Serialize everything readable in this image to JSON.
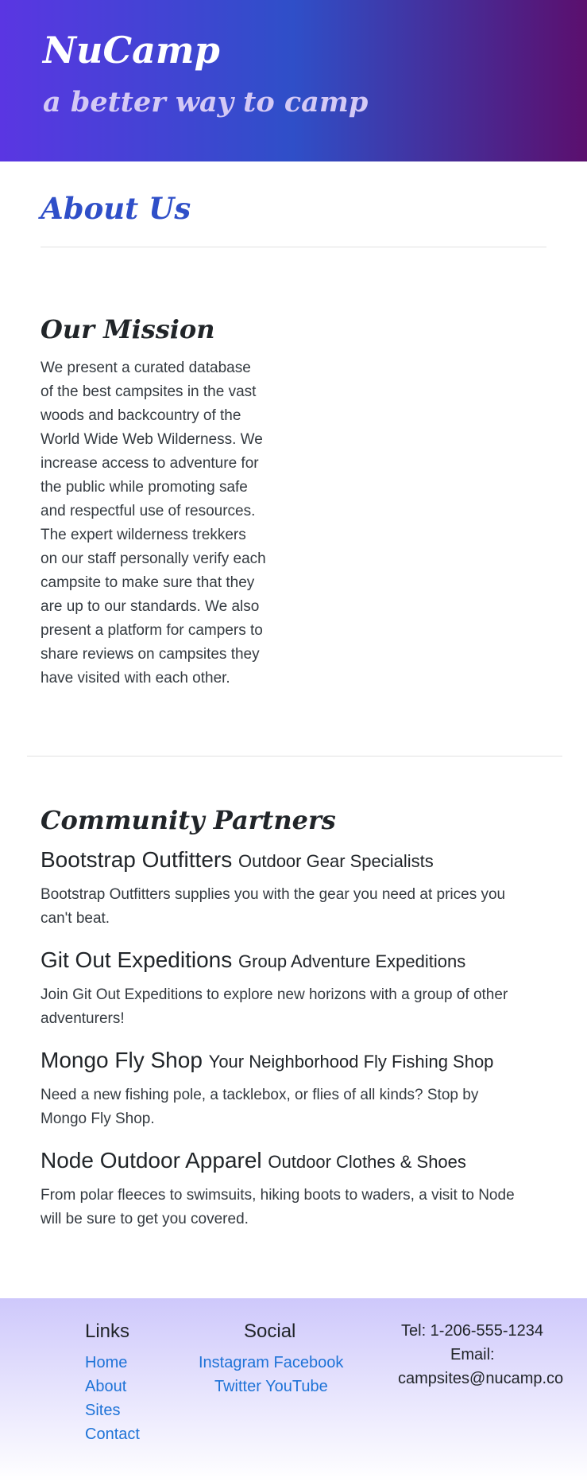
{
  "header": {
    "brand": "NuCamp",
    "tagline": "a better way to camp"
  },
  "about": {
    "title": "About Us"
  },
  "mission": {
    "title": "Our Mission",
    "lines": [
      "We present a curated database",
      "of the best campsites in the vast",
      "woods and backcountry of the",
      "World Wide Web Wilderness. We",
      "increase access to adventure for",
      "the public while promoting safe",
      "and respectful use of resources.",
      "The expert wilderness trekkers",
      "on our staff personally verify each",
      "campsite to make sure that they",
      "are up to our standards. We also",
      "present a platform for campers to",
      "share reviews on campsites they",
      "have visited with each other."
    ]
  },
  "partners": {
    "title": "Community Partners",
    "items": [
      {
        "name": "Bootstrap Outfitters",
        "subtitle": "Outdoor Gear Specialists",
        "lines": [
          "Bootstrap Outfitters supplies you with the gear you need at prices you",
          "can't beat."
        ]
      },
      {
        "name": "Git Out Expeditions",
        "subtitle": "Group Adventure Expeditions",
        "lines": [
          "Join Git Out Expeditions to explore new horizons with a group of other",
          "adventurers!"
        ]
      },
      {
        "name": "Mongo Fly Shop",
        "subtitle": "Your Neighborhood Fly Fishing Shop",
        "lines": [
          "Need a new fishing pole, a tacklebox, or flies of all kinds? Stop by",
          "Mongo Fly Shop."
        ]
      },
      {
        "name": "Node Outdoor Apparel",
        "subtitle": "Outdoor Clothes & Shoes",
        "lines": [
          "From polar fleeces to swimsuits, hiking boots to waders, a visit to Node",
          "will be sure to get you covered."
        ]
      }
    ]
  },
  "footer": {
    "links_title": "Links",
    "links": [
      "Home",
      "About",
      "Sites",
      "Contact"
    ],
    "social_title": "Social",
    "social_row1": "Instagram Facebook",
    "social_row2": "Twitter YouTube",
    "tel": "Tel: 1-206-555-1234",
    "email_label": "Email:",
    "email": "campsites@nucamp.co",
    "link_color": "#1e73d7"
  },
  "colors": {
    "accent": "#2f4fc8",
    "header_start": "#5a36e2",
    "header_end": "#5b0f6e",
    "footer_top": "#cec8fb"
  }
}
